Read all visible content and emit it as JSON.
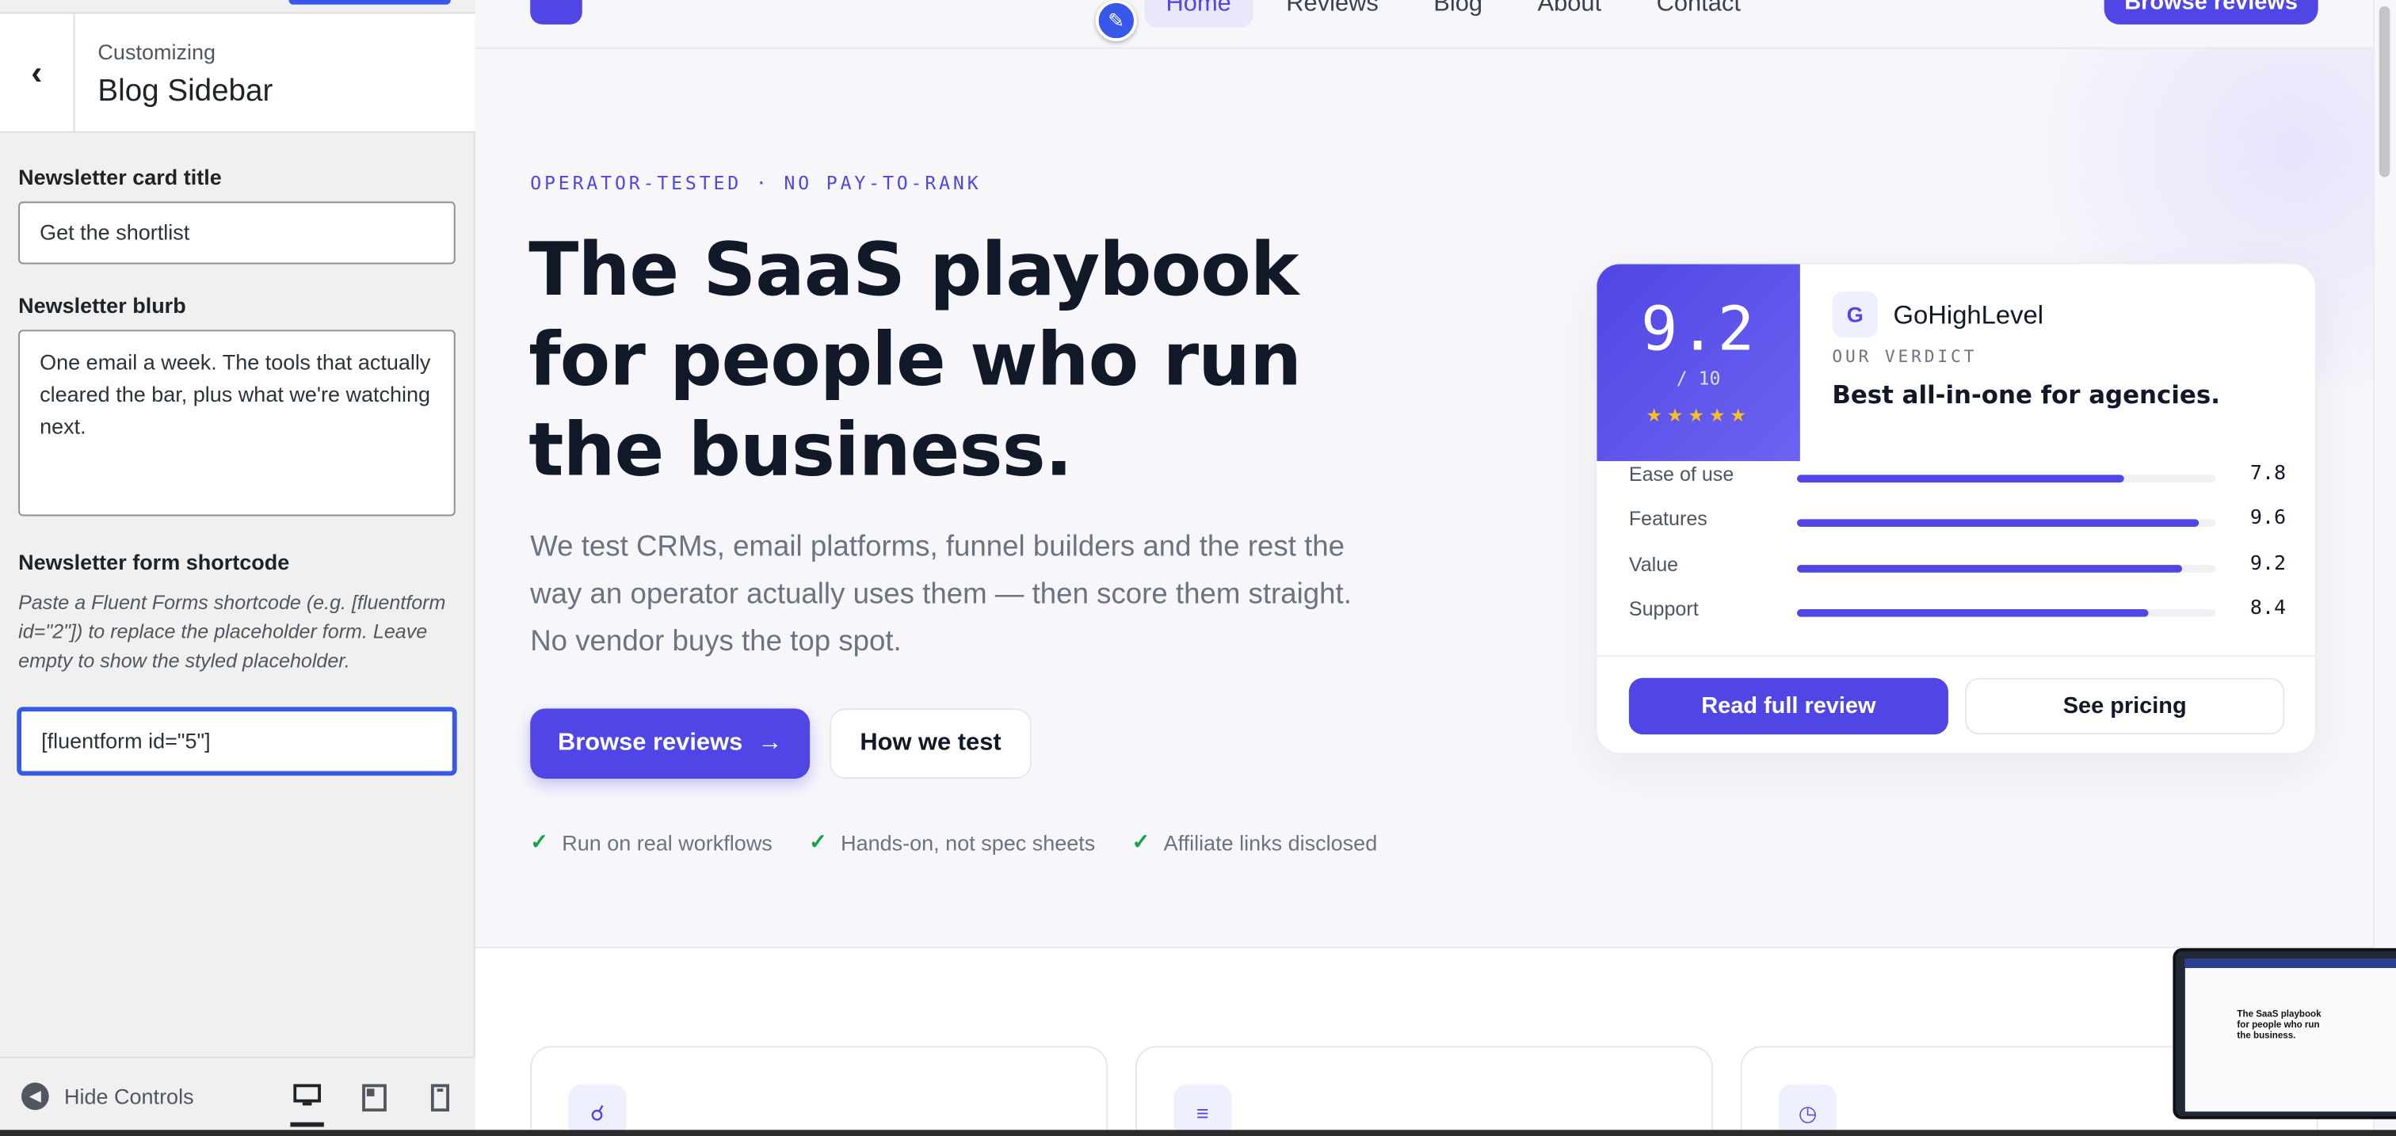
{
  "customizer": {
    "context": "Customizing",
    "section_title": "Blog Sidebar",
    "fields": {
      "title_label": "Newsletter card title",
      "title_value": "Get the shortlist",
      "blurb_label": "Newsletter blurb",
      "blurb_value": "One email a week. The tools that actually cleared the bar, plus what we're watching next.",
      "shortcode_label": "Newsletter form shortcode",
      "shortcode_desc": "Paste a Fluent Forms shortcode (e.g. [fluentform id=\"2\"]) to replace the placeholder form. Leave empty to show the styled placeholder.",
      "shortcode_value": "[fluentform id=\"5\"]"
    },
    "footer": {
      "hide_controls": "Hide Controls"
    }
  },
  "site": {
    "nav": [
      "Home",
      "Reviews",
      "Blog",
      "About",
      "Contact"
    ],
    "cta_top": "Browse reviews"
  },
  "hero": {
    "eyebrow": "OPERATOR-TESTED · NO PAY-TO-RANK",
    "headline": "The SaaS playbook for people who run the business.",
    "lead": "We test CRMs, email platforms, funnel builders and the rest the way an operator actually uses them — then score them straight. No vendor buys the top spot.",
    "primary_button": "Browse reviews",
    "secondary_button": "How we test",
    "checks": [
      "Run on real workflows",
      "Hands-on, not spec sheets",
      "Affiliate links disclosed"
    ]
  },
  "review_card": {
    "score": "9.2",
    "score_denom": "/ 10",
    "stars": "★★★★★",
    "rating_fraction": 0.92,
    "badge_letter": "G",
    "product": "GoHighLevel",
    "verdict_label": "OUR VERDICT",
    "verdict": "Best all-in-one for agencies.",
    "metrics": [
      {
        "label": "Ease of use",
        "value": "7.8",
        "score": 7.8
      },
      {
        "label": "Features",
        "value": "9.6",
        "score": 9.6
      },
      {
        "label": "Value",
        "value": "9.2",
        "score": 9.2
      },
      {
        "label": "Support",
        "value": "8.4",
        "score": 8.4
      }
    ],
    "read_button": "Read full review",
    "pricing_button": "See pricing"
  },
  "thumbnail_headline": "The SaaS playbook for people who run the business.",
  "colors": {
    "accent": "#4f46e5",
    "wp_blue": "#3858e9",
    "check": "#16a34a"
  }
}
